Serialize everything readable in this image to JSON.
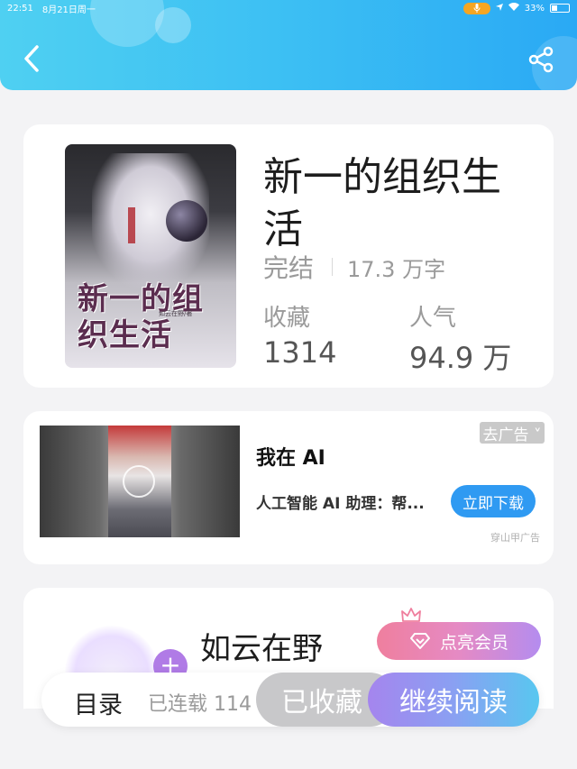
{
  "status_bar": {
    "time": "22:51",
    "date": "8月21日周一",
    "battery": "33%"
  },
  "header": {
    "back_icon": "chevron-left-icon",
    "share_icon": "share-icon",
    "gradient": [
      "#4fd0f2",
      "#2aa9f4"
    ]
  },
  "book": {
    "title": "新一的组织生活",
    "status": "完结",
    "word_count": "17.3 万字",
    "favorites_label": "收藏",
    "favorites_value": "1314",
    "popularity_label": "人气",
    "popularity_value": "94.9 万",
    "cover": {
      "title_text": "新一的组织生活",
      "author_text": "如云在野/著"
    }
  },
  "ad": {
    "remove_label": "去广告 ˅",
    "title": "我在 AI",
    "description": "人工智能 AI 助理：帮...",
    "download_label": "立即下载",
    "source": "穿山甲广告",
    "accent": "#2f9af2"
  },
  "author": {
    "name": "如云在野",
    "plus_label": "+",
    "vip_label": "点亮会员",
    "vip_icon": "diamond-icon",
    "crown_icon": "crown-icon"
  },
  "bottom_bar": {
    "toc_label": "目录",
    "serial_label": "已连载 114",
    "collected_label": "已收藏",
    "continue_label": "继续阅读"
  }
}
